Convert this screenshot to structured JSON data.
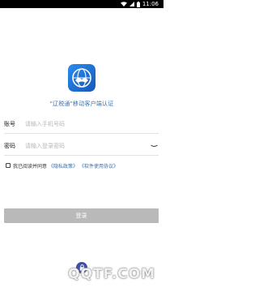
{
  "status_bar": {
    "time": "11:06",
    "background": "#000000"
  },
  "app": {
    "name": "\"辽税通\"移动客户端认证",
    "logo": "globe-handshake-logo",
    "brand_color": "#1d6fd6"
  },
  "form": {
    "account": {
      "label": "账号",
      "placeholder": "请输入手机号码",
      "value": ""
    },
    "password": {
      "label": "密码",
      "placeholder": "请输入登录密码",
      "value": "",
      "toggle_icon": "eye-off-icon"
    },
    "agreement": {
      "checked": false,
      "text": "我已阅读并同意",
      "privacy_link": "《隐私政策》",
      "terms_link": "《软件使用协议》"
    },
    "login_label": "登录",
    "login_color": "#b9b9b9"
  },
  "bottom_icon": "lock-icon",
  "watermark": "QQTF.COM"
}
